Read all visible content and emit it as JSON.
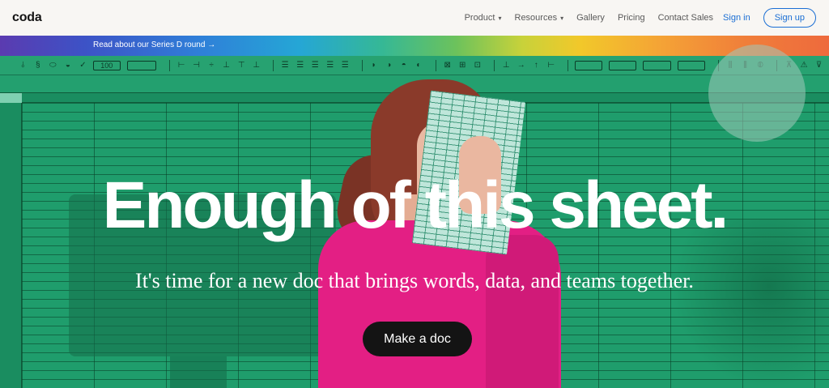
{
  "nav": {
    "logo": "coda",
    "links": [
      {
        "label": "Product",
        "has_dropdown": true
      },
      {
        "label": "Resources",
        "has_dropdown": true
      },
      {
        "label": "Gallery",
        "has_dropdown": false
      },
      {
        "label": "Pricing",
        "has_dropdown": false
      },
      {
        "label": "Contact Sales",
        "has_dropdown": false
      }
    ],
    "signin": "Sign in",
    "signup": "Sign up",
    "chevron_icon": "▾"
  },
  "banner": {
    "text": "Read about our Series D round →"
  },
  "hero": {
    "headline": "Enough of this sheet.",
    "subhead": "It's time for a new doc that brings words, data, and teams together.",
    "cta": "Make a doc"
  },
  "toolbar": {
    "font_size": "100",
    "icons": [
      "align-icon",
      "dollar-icon",
      "pill-icon",
      "pie-icon",
      "check-icon",
      "size-select-icon",
      "wave-select-icon",
      "align-group-icon",
      "justify-group-icon",
      "shape-group-icon",
      "grid-group-icon",
      "pin-group-icon",
      "table-group-icon",
      "column-group-icon"
    ]
  },
  "colors": {
    "accent": "#1a6ed4",
    "sheet_green": "#1f9d6c",
    "shirt_pink": "#e31f84",
    "cta_black": "#141414"
  }
}
